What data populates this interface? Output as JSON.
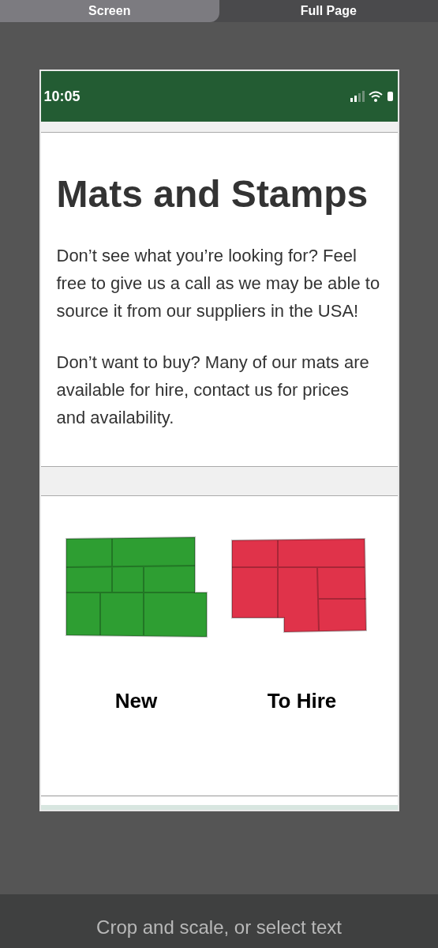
{
  "tabs": [
    {
      "label": "Screen",
      "selected": true
    },
    {
      "label": "Full Page",
      "selected": false
    }
  ],
  "phone": {
    "time": "10:05",
    "title": "Mats and Stamps",
    "paragraphs": [
      "Don’t see what you’re looking for? Feel free to give us a call as we may be able to source it from our suppliers in the USA!",
      "Don’t want to buy? Many of our mats are available for hire, contact us for prices and availability."
    ],
    "products": [
      {
        "label": "New",
        "color": "#2e9e32"
      },
      {
        "label": "To Hire",
        "color": "#e0334a"
      }
    ]
  },
  "hint": "Crop and scale, or select text"
}
